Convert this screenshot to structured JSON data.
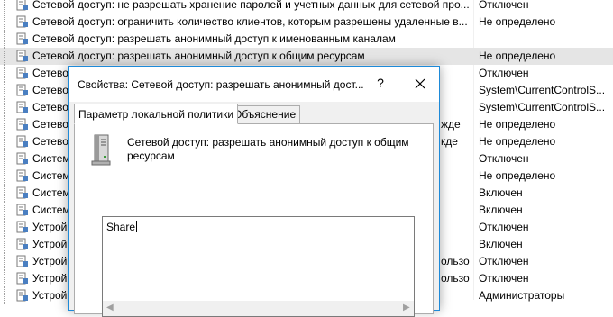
{
  "policy_rows": [
    {
      "name": "Сетевой доступ: не разрешать хранение паролей и учетных данных для сетевой про...",
      "value": "Отключен"
    },
    {
      "name": "Сетевой доступ: ограничить количество клиентов, которым разрешены удаленные в...",
      "value": "Не определено"
    },
    {
      "name": "Сетевой доступ: разрешать анонимный доступ к именованным каналам",
      "value": ""
    },
    {
      "name": "Сетевой доступ: разрешать анонимный доступ к общим ресурсам",
      "value": "Не определено"
    },
    {
      "name": "Сетевой",
      "value": "Отключен"
    },
    {
      "name": "Сетевой",
      "value": "System\\CurrentControlS..."
    },
    {
      "name": "Сетевой",
      "value": "System\\CurrentControlS..."
    },
    {
      "name": "Сетевой",
      "value": "Не определено"
    },
    {
      "name": "Сетевой",
      "value": "Не определено"
    },
    {
      "name": "Систем",
      "value": "Отключен"
    },
    {
      "name": "Систем",
      "value": "Не определено"
    },
    {
      "name": "Систем",
      "value": "Включен"
    },
    {
      "name": "Систем",
      "value": "Включен"
    },
    {
      "name": "Устрой",
      "value": "Отключен"
    },
    {
      "name": "Устрой",
      "value": "Включен"
    },
    {
      "name": "Устрой",
      "value": "Отключен"
    },
    {
      "name": "Устрой",
      "value": "Отключен"
    },
    {
      "name": "Устрой",
      "value": "Администраторы"
    }
  ],
  "row_fragments": [
    {
      "row": 7,
      "text": "жде"
    },
    {
      "row": 8,
      "text": "кде"
    },
    {
      "row": 15,
      "text": "ользо"
    },
    {
      "row": 16,
      "text": "ользо"
    }
  ],
  "dialog": {
    "title": "Свойства: Сетевой доступ: разрешать анонимный дост...",
    "help_label": "?",
    "tabs": [
      {
        "label": "Параметр локальной политики",
        "active": true
      },
      {
        "label": "Объяснение",
        "active": false
      }
    ],
    "policy_name": "Сетевой доступ: разрешать анонимный доступ к общим ресурсам",
    "share_value": "Share"
  },
  "colors": {
    "selection": "#e5e5e5",
    "dialog_border": "#1e8ad8",
    "dialog_bg": "#f0f0f0"
  },
  "icons": {
    "row_icon": "policy-setting-icon",
    "server_icon": "server-tower-icon",
    "close_icon": "close-icon"
  }
}
